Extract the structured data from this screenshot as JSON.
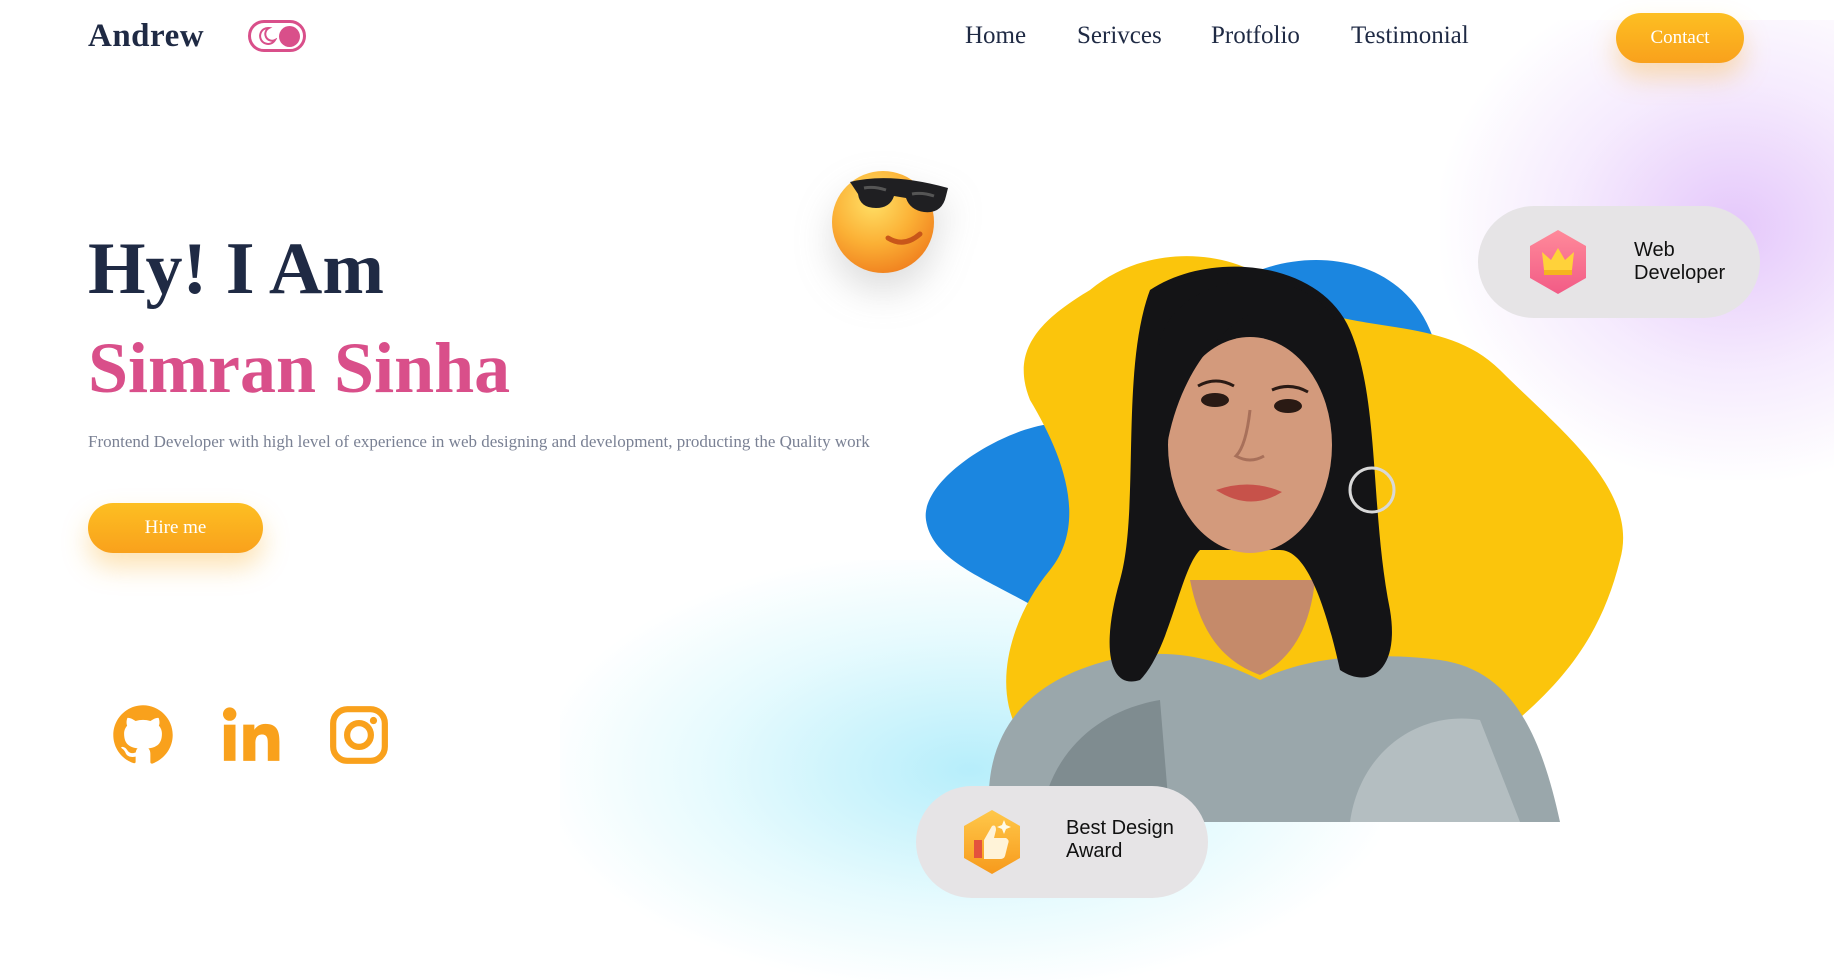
{
  "nav": {
    "logo": "Andrew",
    "links": [
      "Home",
      "Serivces",
      "Protfolio",
      "Testimonial"
    ],
    "contact_label": "Contact"
  },
  "hero": {
    "greeting": "Hy! I Am",
    "name": "Simran Sinha",
    "description": "Frontend Developer with high level of experience in web designing and development, producting the Quality work",
    "cta_label": "Hire me"
  },
  "badges": {
    "role": [
      "Web",
      "Developer"
    ],
    "award": [
      "Best Design",
      "Award"
    ]
  },
  "social": [
    {
      "icon": "github-icon"
    },
    {
      "icon": "linkedin-icon"
    },
    {
      "icon": "instagram-icon"
    }
  ],
  "colors": {
    "primary_text": "#1f2a44",
    "accent_pink": "#d94f8a",
    "button_orange": "#fdb022",
    "blob_yellow": "#fbc50c",
    "blob_blue": "#1b86e0",
    "badge_bg": "#e6e4e6"
  }
}
